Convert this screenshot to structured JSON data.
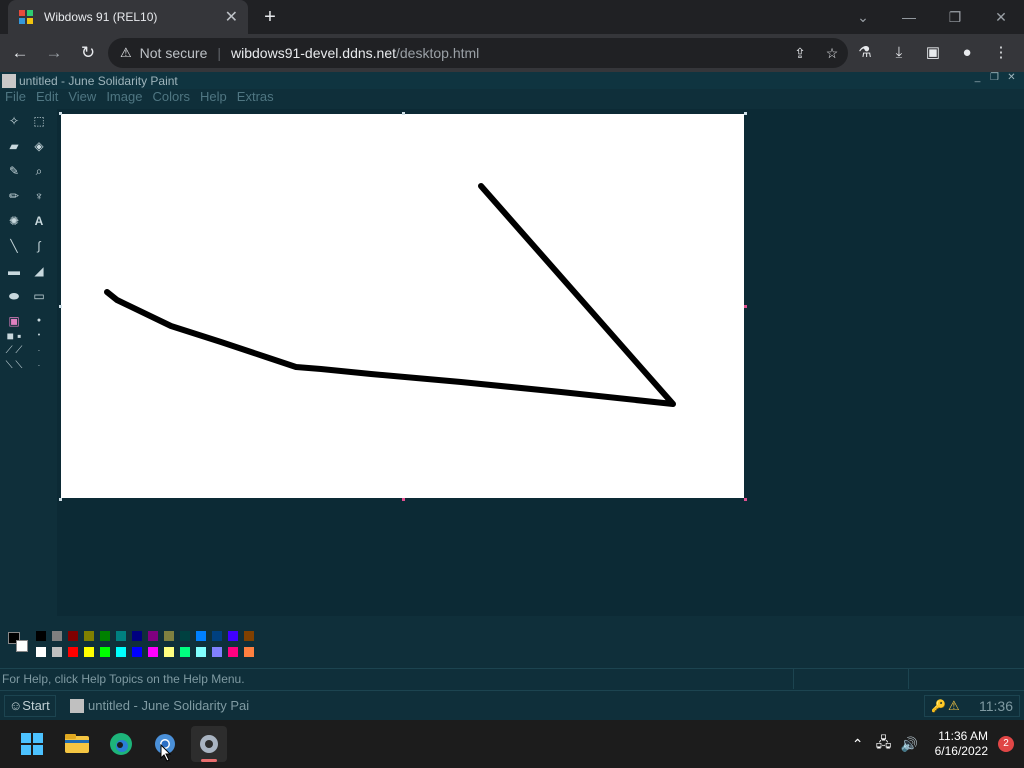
{
  "browser": {
    "tab_title": "Wibdows 91 (REL10)",
    "tab_close": "✕",
    "new_tab": "+",
    "security_label": "Not secure",
    "url_host": "wibdows91-devel.ddns.net",
    "url_path": "/desktop.html"
  },
  "paint": {
    "window_title": "untitled - June Solidarity Paint",
    "menu": [
      "File",
      "Edit",
      "View",
      "Image",
      "Colors",
      "Help",
      "Extras"
    ],
    "status_text": "For Help, click Help Topics on the Help Menu.",
    "palette": [
      "#000000",
      "#808080",
      "#800000",
      "#808000",
      "#008000",
      "#008080",
      "#000080",
      "#800080",
      "#808040",
      "#004040",
      "#0080ff",
      "#004080",
      "#4000ff",
      "#804000",
      "#ffffff",
      "#c0c0c0",
      "#ff0000",
      "#ffff00",
      "#00ff00",
      "#00ffff",
      "#0000ff",
      "#ff00ff",
      "#ffff80",
      "#00ff80",
      "#80ffff",
      "#8080ff",
      "#ff0080",
      "#ff8040"
    ],
    "stroke_color": "#000000"
  },
  "w91_taskbar": {
    "start_label": "Start",
    "task_label": "untitled - June Solidarity Pai",
    "clock": "11:36"
  },
  "win11": {
    "time": "11:36 AM",
    "date": "6/16/2022",
    "notifications": "2"
  }
}
